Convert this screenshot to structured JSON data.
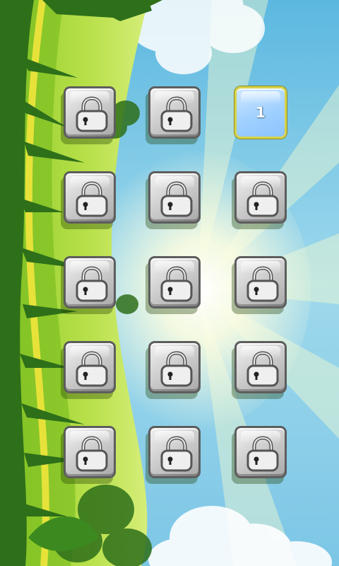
{
  "level_select": {
    "tiles": [
      {
        "state": "locked",
        "icon": "padlock-icon"
      },
      {
        "state": "locked",
        "icon": "padlock-icon"
      },
      {
        "state": "unlocked",
        "label": "1"
      },
      {
        "state": "locked",
        "icon": "padlock-icon"
      },
      {
        "state": "locked",
        "icon": "padlock-icon"
      },
      {
        "state": "locked",
        "icon": "padlock-icon"
      },
      {
        "state": "locked",
        "icon": "padlock-icon"
      },
      {
        "state": "locked",
        "icon": "padlock-icon"
      },
      {
        "state": "locked",
        "icon": "padlock-icon"
      },
      {
        "state": "locked",
        "icon": "padlock-icon"
      },
      {
        "state": "locked",
        "icon": "padlock-icon"
      },
      {
        "state": "locked",
        "icon": "padlock-icon"
      },
      {
        "state": "locked",
        "icon": "padlock-icon"
      },
      {
        "state": "locked",
        "icon": "padlock-icon"
      },
      {
        "state": "locked",
        "icon": "padlock-icon"
      }
    ]
  },
  "colors": {
    "sky_top": "#5fb9df",
    "sky_bottom": "#bfe8f2",
    "grass_light": "#a6d83b",
    "grass_dark": "#2e6f1a",
    "unlocked_tile": "#9fd0ff",
    "unlocked_border": "#d7d24a",
    "locked_tile": "#c8c8c8"
  }
}
